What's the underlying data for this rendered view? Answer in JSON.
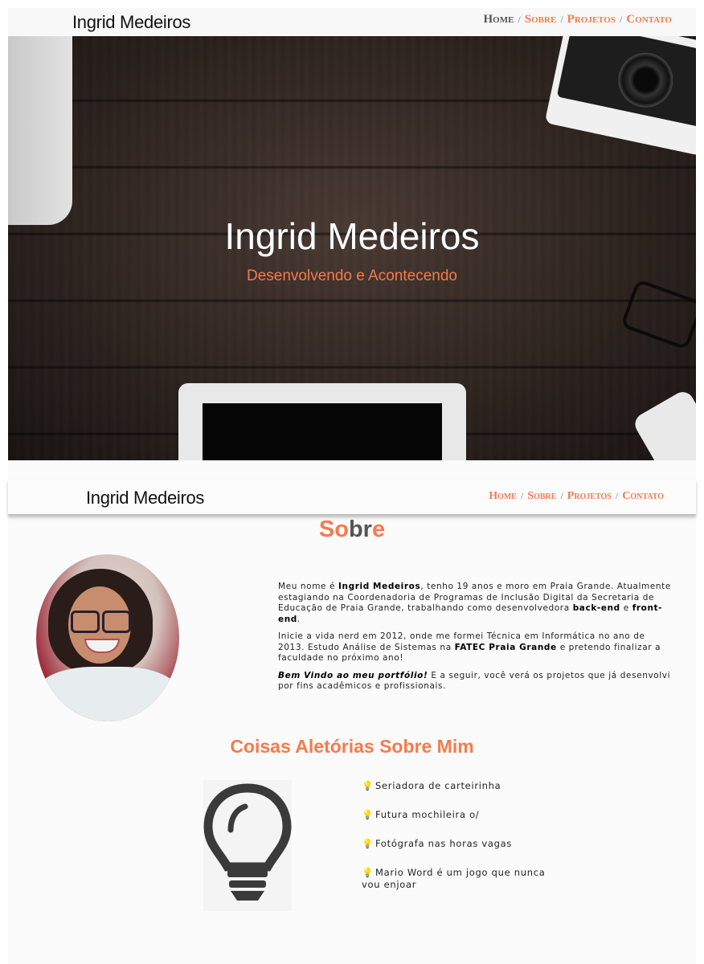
{
  "header": {
    "brand": "Ingrid Medeiros",
    "nav": [
      "Home",
      "Sobre",
      "Projetos",
      "Contato"
    ],
    "separator": "/"
  },
  "hero": {
    "title": "Ingrid Medeiros",
    "subtitle": "Desenvolvendo e Acontecendo"
  },
  "navbar2": {
    "brand": "Ingrid Medeiros",
    "nav": [
      "Home",
      "Sobre",
      "Projetos",
      "Contato"
    ]
  },
  "about": {
    "title_part1": "So",
    "title_part2": "br",
    "title_part3": "e",
    "p1_a": "Meu nome é ",
    "p1_b": "Ingrid Medeiros",
    "p1_c": ", tenho 19 anos e moro em Praia Grande. Atualmente estagiando na Coordenadoria de Programas de Inclusão Digital da Secretaria de Educação de Praia Grande, trabalhando como desenvolvedora ",
    "p1_d": "back-end",
    "p1_e": " e ",
    "p1_f": "front-end",
    "p1_g": ".",
    "p2_a": "Inicie a vida nerd em 2012, onde me formei Técnica em Informática no ano de 2013. Estudo Análise de Sistemas na ",
    "p2_b": "FATEC Praia Grande",
    "p2_c": " e pretendo finalizar a faculdade no próximo ano!",
    "p3_a": "Bem Vindo ao meu portfólio!",
    "p3_b": " E a seguir, você verá os projetos que já desenvolvi por fins acadêmicos e profissionais."
  },
  "random": {
    "title": "Coisas Aletórias Sobre Mim",
    "icon": "lightbulb-icon",
    "items": [
      "Seriadora de carteirinha",
      "Futura mochileira o/",
      "Fotógrafa nas horas vagas",
      "Mario Word é um jogo que nunca vou enjoar"
    ]
  },
  "colors": {
    "accent": "#f47b4c",
    "text": "#222222"
  }
}
